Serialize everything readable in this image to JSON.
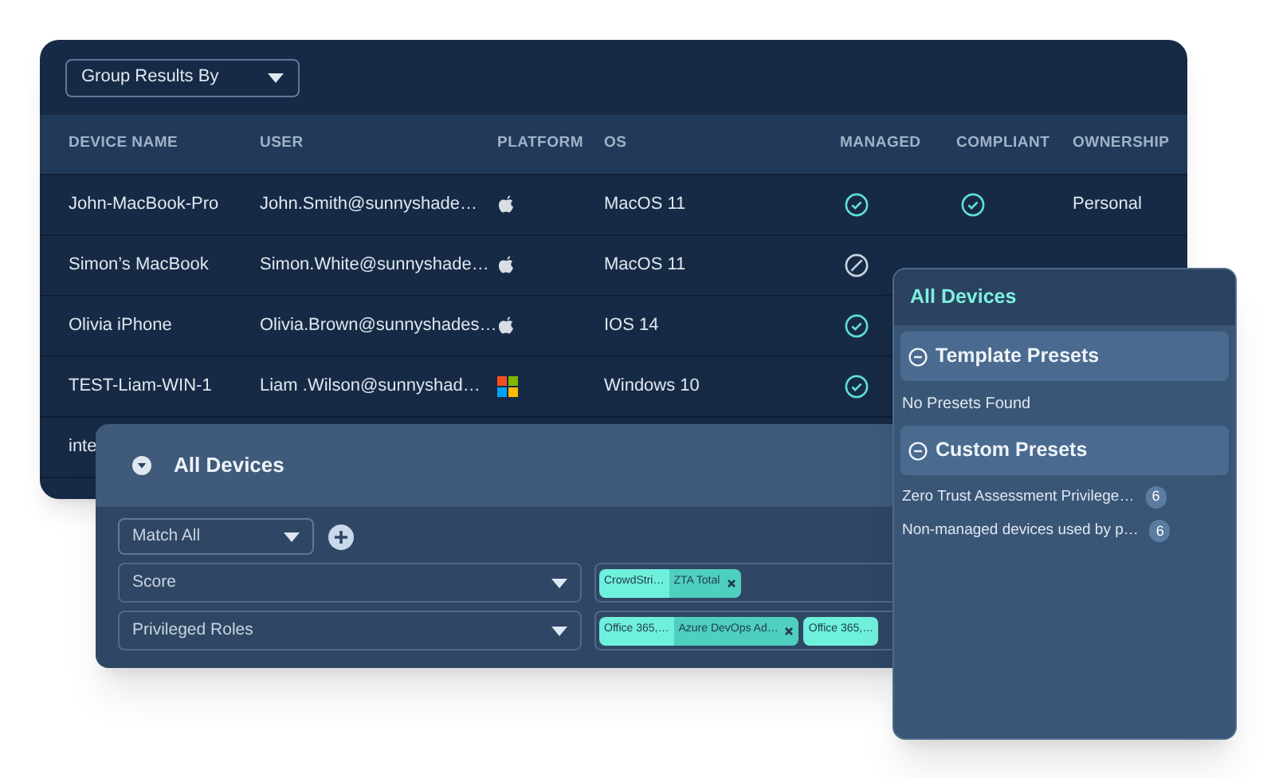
{
  "devices_table": {
    "group_by": {
      "label": "Group Results By"
    },
    "columns": [
      "DEVICE NAME",
      "USER",
      "PLATFORM",
      "OS",
      "MANAGED",
      "COMPLIANT",
      "OWNERSHIP"
    ],
    "rows": [
      {
        "device_name": "John-MacBook-Pro",
        "user": "John.Smith@sunnyshade…",
        "platform": {
          "kind": "apple"
        },
        "os": "MacOS 11",
        "managed": true,
        "compliant": true,
        "ownership": "Personal"
      },
      {
        "device_name": "Simon’s MacBook",
        "user": "Simon.White@sunnyshade…",
        "platform": {
          "kind": "apple"
        },
        "os": "MacOS 11",
        "managed": false
      },
      {
        "device_name": "Olivia iPhone",
        "user": "Olivia.Brown@sunnyshades…",
        "platform": {
          "kind": "apple"
        },
        "os": "IOS 14",
        "managed": true
      },
      {
        "device_name": "TEST-Liam-WIN-1",
        "user": "Liam .Wilson@sunnyshad…",
        "platform": {
          "kind": "windows"
        },
        "os": "Windows 10",
        "managed": true
      },
      {
        "device_name": "inte"
      }
    ]
  },
  "filter_panel": {
    "title": "All Devices",
    "expanded": true,
    "match": {
      "label": "Match All"
    },
    "filters": [
      {
        "field": "Score",
        "tags": [
          {
            "source": "CrowdStri…",
            "value": "ZTA Total",
            "removable": true
          }
        ]
      },
      {
        "field": "Privileged Roles",
        "tags": [
          {
            "source": "Office 365,…",
            "value": "Azure DevOps Ad…",
            "removable": true
          },
          {
            "source": "Office 365,…"
          }
        ]
      }
    ]
  },
  "presets_panel": {
    "title": "All Devices",
    "sections": [
      {
        "title": "Template Presets",
        "expanded": true,
        "empty_text": "No Presets Found"
      },
      {
        "title": "Custom Presets",
        "expanded": true,
        "items": [
          {
            "label": "Zero Trust Assessment Privilege…",
            "count": "6"
          },
          {
            "label": "Non-managed devices used by p…",
            "count": "6"
          }
        ]
      }
    ]
  }
}
